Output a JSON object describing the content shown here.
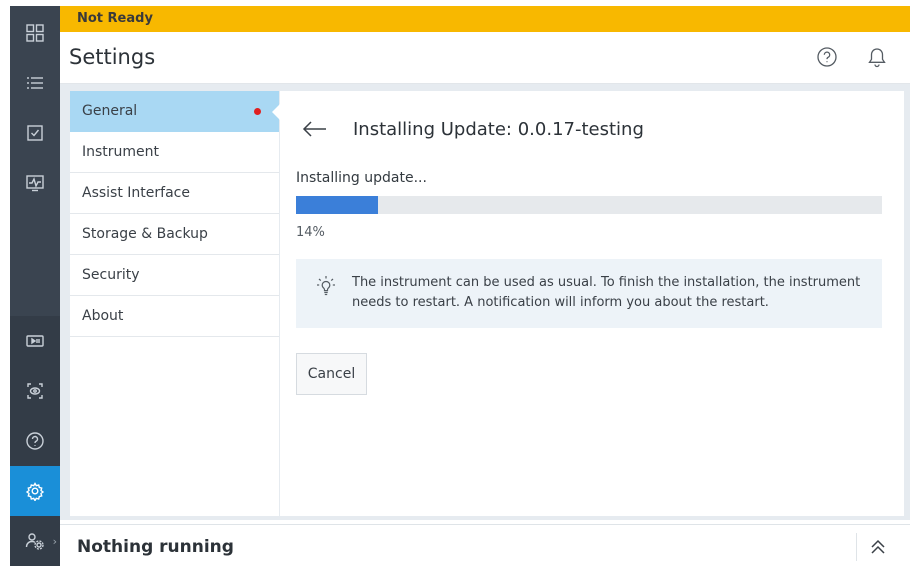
{
  "status_banner": {
    "text": "Not Ready",
    "color": "#f8b800"
  },
  "header": {
    "title": "Settings",
    "icons": [
      "help-icon",
      "bell-icon"
    ]
  },
  "rail": {
    "items": [
      {
        "icon": "dashboard-grid-icon"
      },
      {
        "icon": "list-icon"
      },
      {
        "icon": "checkbox-icon"
      },
      {
        "icon": "monitor-chart-icon"
      },
      {
        "icon": "media-control-icon"
      },
      {
        "icon": "camera-eye-icon"
      },
      {
        "icon": "help-icon"
      },
      {
        "icon": "gear-icon",
        "active": true
      },
      {
        "icon": "user-settings-icon"
      }
    ],
    "active_color": "#1a8fd8"
  },
  "settings_nav": {
    "items": [
      {
        "label": "General",
        "active": true,
        "has_notification": true
      },
      {
        "label": "Instrument"
      },
      {
        "label": "Assist Interface"
      },
      {
        "label": "Storage & Backup"
      },
      {
        "label": "Security"
      },
      {
        "label": "About"
      }
    ]
  },
  "update": {
    "title": "Installing Update: 0.0.17-testing",
    "progress_label": "Installing update...",
    "progress": 0.14,
    "progress_text": "14%",
    "progress_color": "#3b7fd9",
    "info_text": "The instrument can be used as usual. To finish the installation, the instrument needs to restart. A notification will inform you about the restart.",
    "cancel_label": "Cancel"
  },
  "footer": {
    "status_text": "Nothing running"
  }
}
